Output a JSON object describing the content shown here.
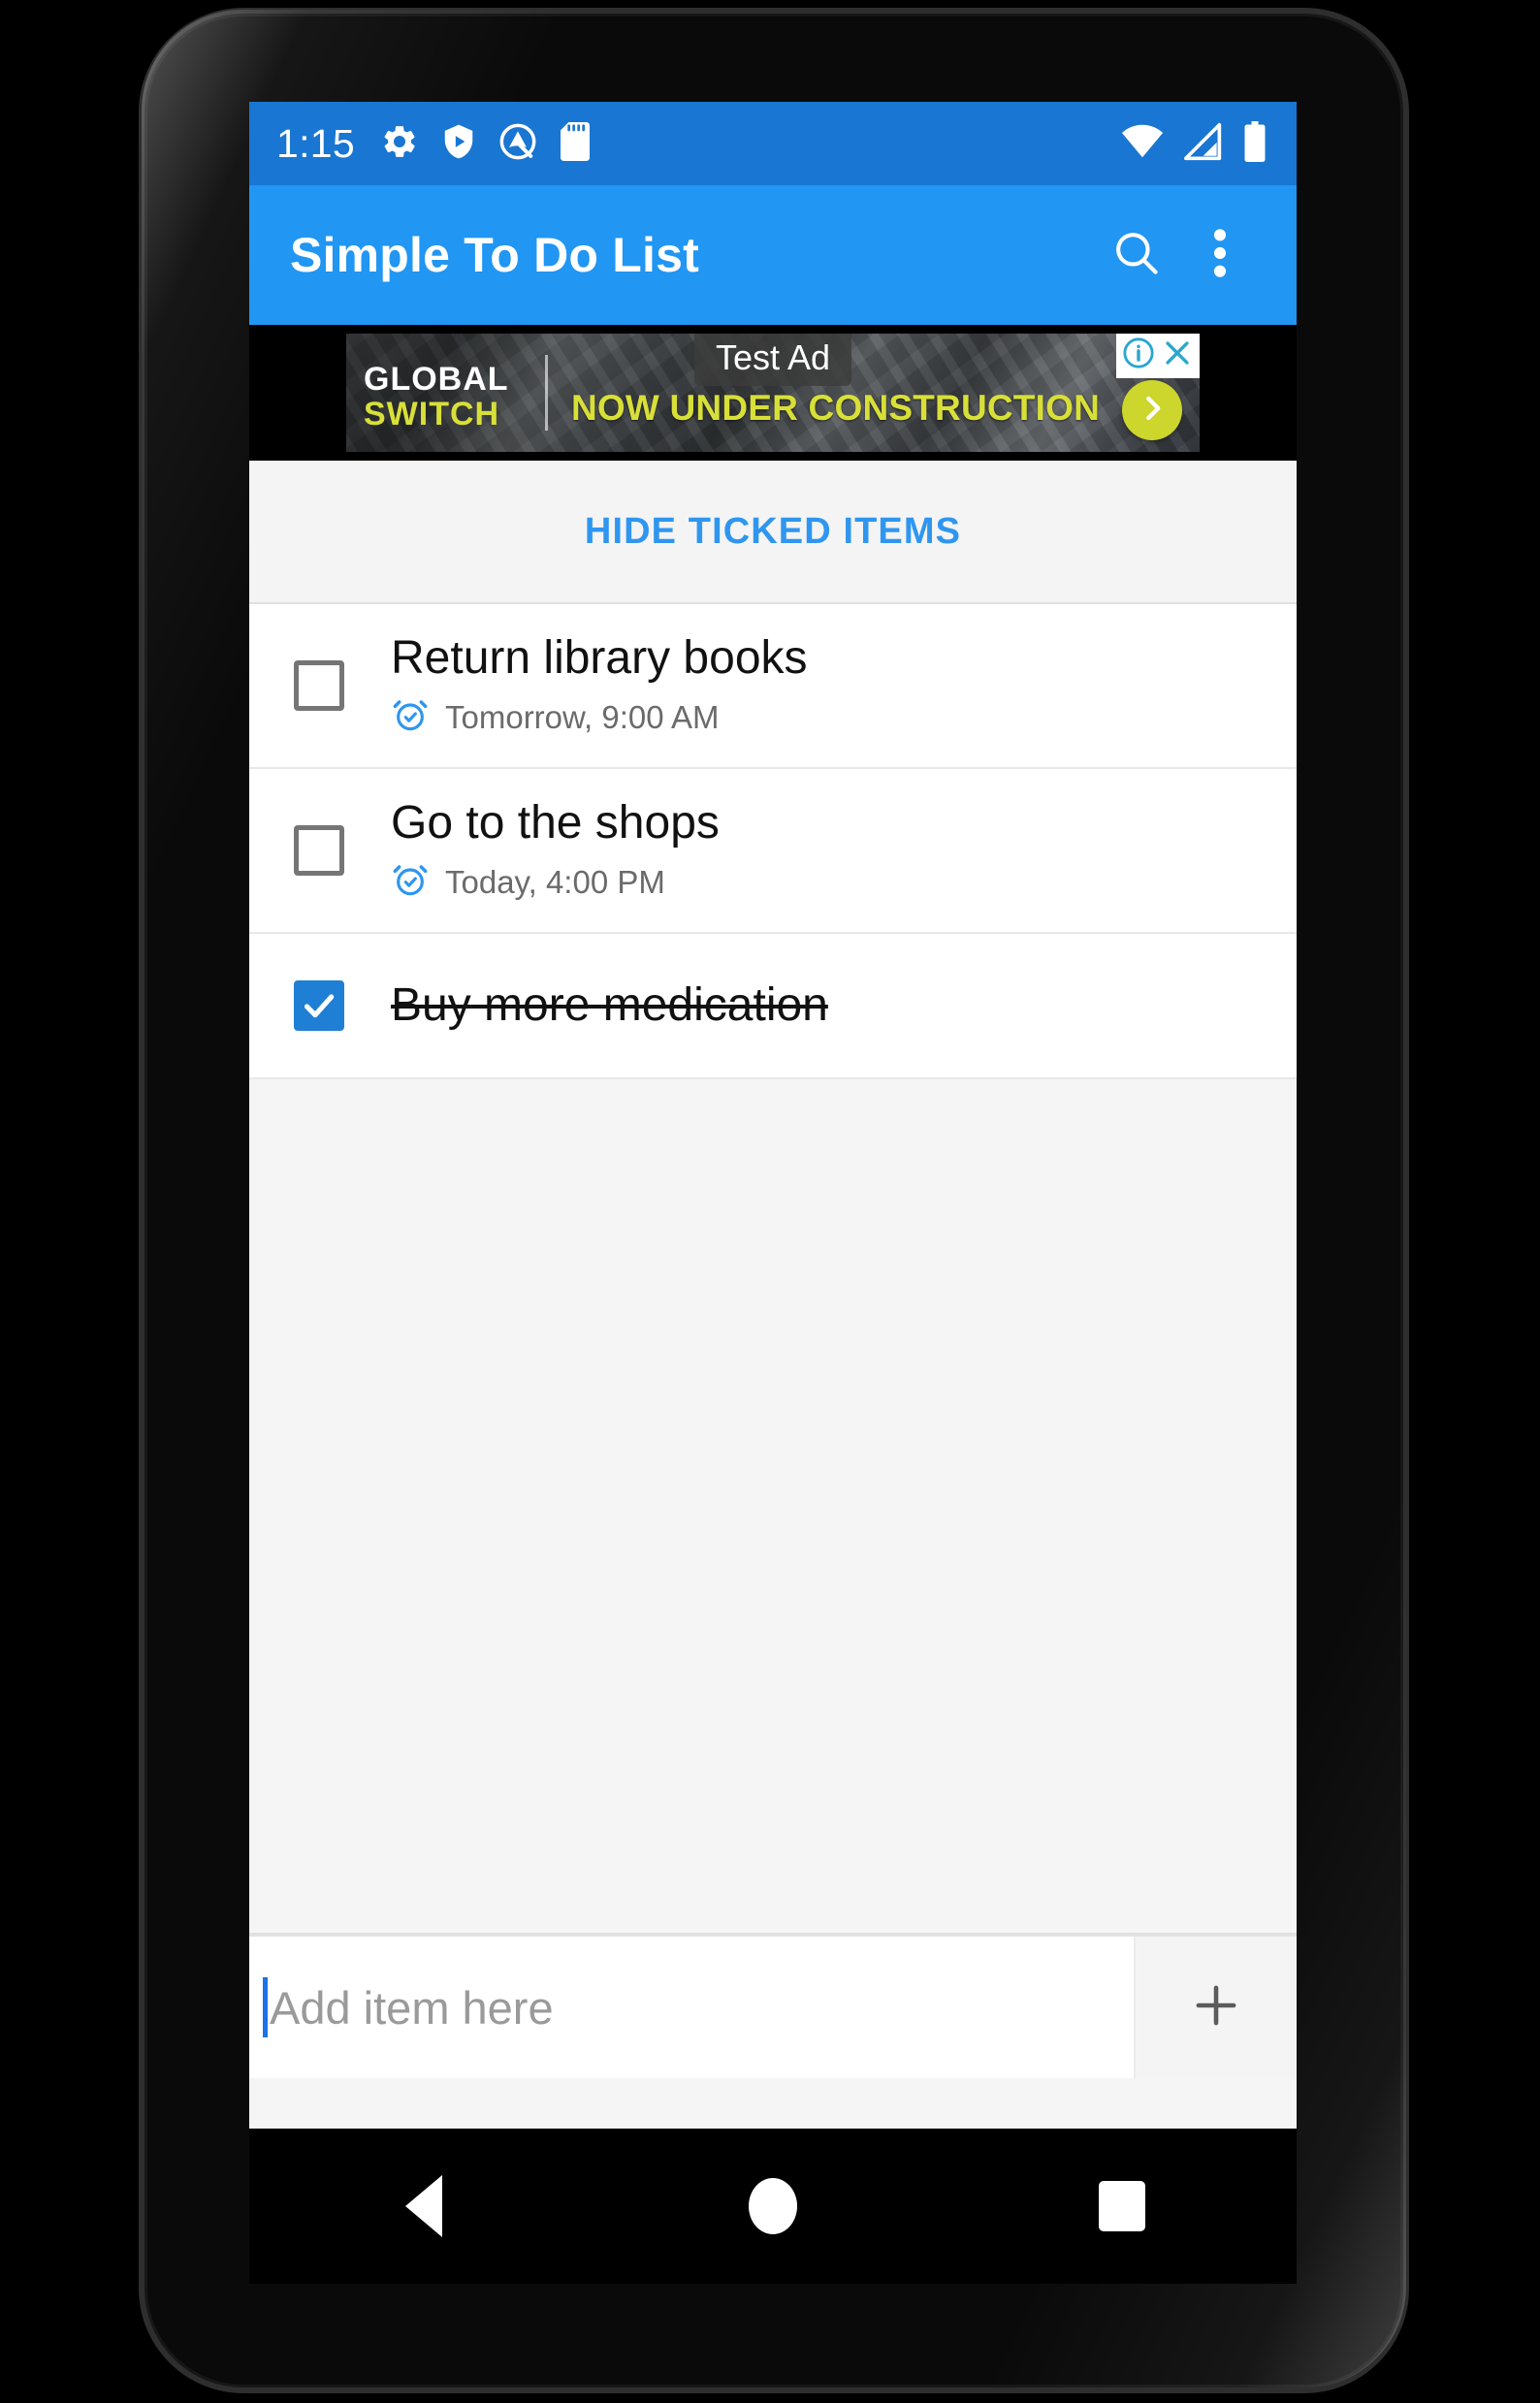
{
  "device": {
    "status_bar": {
      "clock": "1:15",
      "left_icons": [
        "settings-gear-icon",
        "shield-play-icon",
        "circle-q-icon",
        "sd-card-icon"
      ],
      "right_icons": [
        "wifi-icon",
        "cell-signal-none-icon",
        "battery-full-icon"
      ],
      "background_color": "#1976D2"
    },
    "nav_bar": {
      "back_label": "Back",
      "home_label": "Home",
      "recents_label": "Recents"
    }
  },
  "app_bar": {
    "title": "Simple To Do List",
    "search_icon": "search-icon",
    "overflow_icon": "more-vertical-icon",
    "background_color": "#2196F3"
  },
  "ad": {
    "label": "Test Ad",
    "brand_line1": "GLOBAL",
    "brand_line2": "SWITCH",
    "headline": "NOW UNDER CONSTRUCTION",
    "info_icon": "info-icon",
    "close_icon": "close-icon",
    "cta_icon": "chevron-right-icon",
    "accent_color": "#D8E038"
  },
  "toolbar": {
    "hide_ticked_label": "HIDE TICKED ITEMS",
    "accent_color": "#2F96F0"
  },
  "todo_items": [
    {
      "title": "Return library books",
      "checked": false,
      "reminder": "Tomorrow, 9:00 AM",
      "reminder_icon": "alarm-clock-icon"
    },
    {
      "title": "Go to the shops",
      "checked": false,
      "reminder": "Today, 4:00 PM",
      "reminder_icon": "alarm-clock-icon"
    },
    {
      "title": "Buy more medication",
      "checked": true,
      "reminder": null,
      "reminder_icon": null
    }
  ],
  "add_bar": {
    "placeholder": "Add item here",
    "value": "",
    "add_icon": "plus-icon"
  }
}
